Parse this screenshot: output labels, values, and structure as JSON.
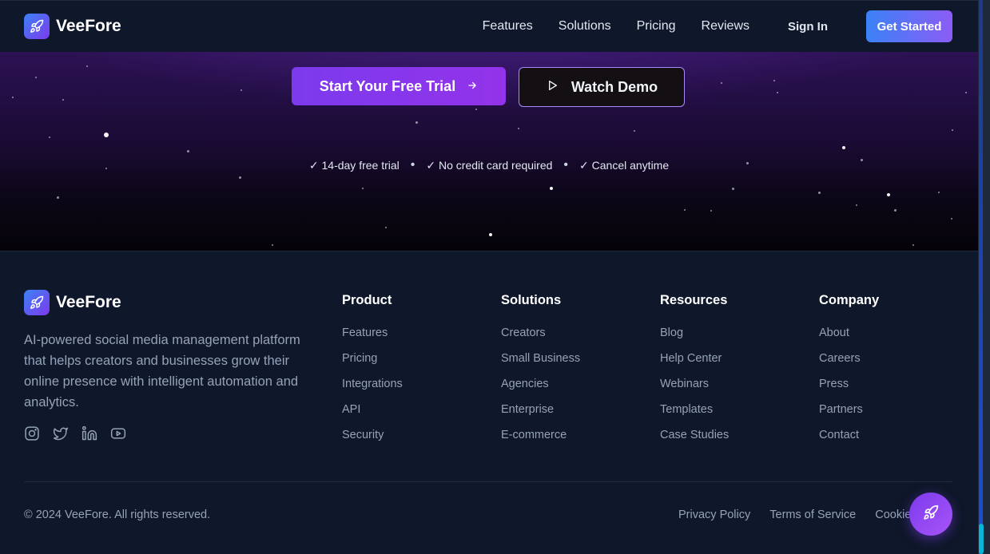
{
  "nav": {
    "brand": "VeeFore",
    "links": [
      "Features",
      "Solutions",
      "Pricing",
      "Reviews"
    ],
    "sign_in": "Sign In",
    "get_started": "Get Started"
  },
  "hero": {
    "primary_cta": "Start Your Free Trial",
    "secondary_cta": "Watch Demo",
    "perks": [
      "✓ 14-day free trial",
      "✓ No credit card required",
      "✓ Cancel anytime"
    ]
  },
  "footer": {
    "brand": "VeeFore",
    "description": "AI-powered social media management platform that helps creators and businesses grow their online presence with intelligent automation and analytics.",
    "socials": [
      "instagram-icon",
      "twitter-icon",
      "linkedin-icon",
      "youtube-icon"
    ],
    "columns": [
      {
        "title": "Product",
        "items": [
          "Features",
          "Pricing",
          "Integrations",
          "API",
          "Security"
        ]
      },
      {
        "title": "Solutions",
        "items": [
          "Creators",
          "Small Business",
          "Agencies",
          "Enterprise",
          "E-commerce"
        ]
      },
      {
        "title": "Resources",
        "items": [
          "Blog",
          "Help Center",
          "Webinars",
          "Templates",
          "Case Studies"
        ]
      },
      {
        "title": "Company",
        "items": [
          "About",
          "Careers",
          "Press",
          "Partners",
          "Contact"
        ]
      }
    ],
    "copyright": "© 2024 VeeFore. All rights reserved.",
    "legal": [
      "Privacy Policy",
      "Terms of Service",
      "Cookies"
    ]
  },
  "colors": {
    "accent": "#7c3aed",
    "primary_blue": "#3b82f6",
    "background": "#0f172a",
    "scroll_thumb": "#06b6d4"
  }
}
